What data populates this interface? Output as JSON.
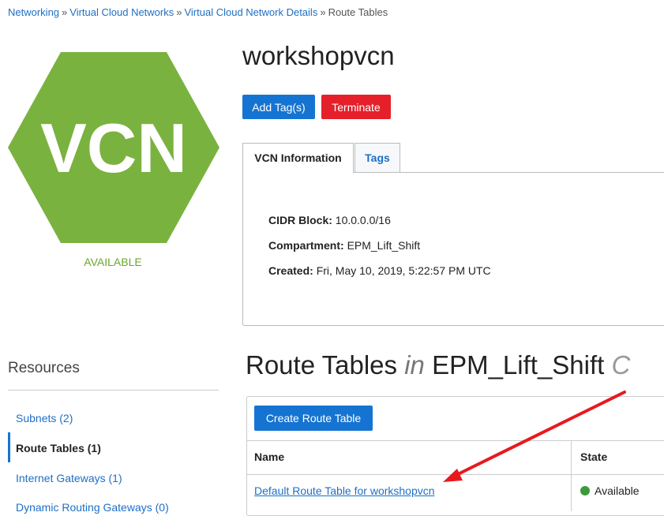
{
  "breadcrumb": {
    "items": [
      "Networking",
      "Virtual Cloud Networks",
      "Virtual Cloud Network Details"
    ],
    "current": "Route Tables",
    "separator": "»"
  },
  "vcn": {
    "icon_text": "VCN",
    "status": "AVAILABLE",
    "name": "workshopvcn"
  },
  "actions": {
    "add_tags": "Add Tag(s)",
    "terminate": "Terminate"
  },
  "tabs": {
    "info": "VCN Information",
    "tags": "Tags"
  },
  "info": {
    "cidr_label": "CIDR Block:",
    "cidr_value": "10.0.0.0/16",
    "compartment_label": "Compartment:",
    "compartment_value": "EPM_Lift_Shift",
    "created_label": "Created:",
    "created_value": "Fri, May 10, 2019, 5:22:57 PM UTC"
  },
  "resources": {
    "heading": "Resources",
    "items": [
      "Subnets (2)",
      "Route Tables (1)",
      "Internet Gateways (1)",
      "Dynamic Routing Gateways (0)"
    ]
  },
  "route_tables": {
    "heading_main": "Route Tables",
    "heading_in": "in",
    "heading_compartment": "EPM_Lift_Shift",
    "heading_tail": "C",
    "create_button": "Create Route Table",
    "columns": [
      "Name",
      "State"
    ],
    "rows": [
      {
        "name": "Default Route Table for workshopvcn",
        "state": "Available"
      }
    ]
  },
  "colors": {
    "vcn_green": "#7ab23f",
    "link_blue": "#1f6fc5",
    "button_blue": "#1574d2",
    "button_red": "#e5202a",
    "available_green": "#3c9a3c",
    "annotation_arrow": "#e8191e"
  }
}
